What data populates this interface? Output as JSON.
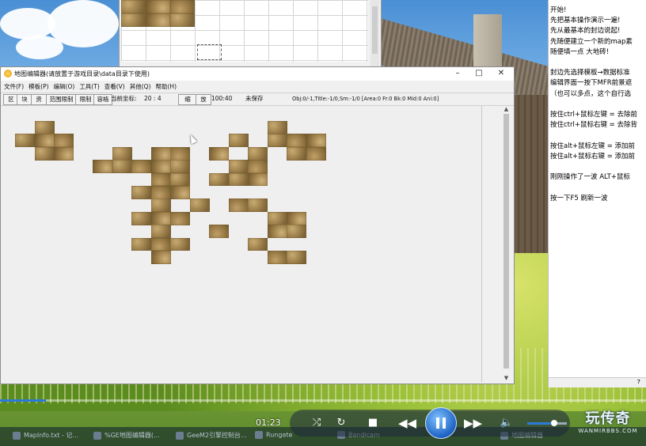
{
  "top_window": {
    "grid_tiles": [
      [
        0,
        0
      ],
      [
        1,
        0
      ],
      [
        2,
        0
      ],
      [
        0,
        1
      ],
      [
        1,
        1
      ],
      [
        2,
        1
      ]
    ]
  },
  "editor": {
    "title": "地图编辑器(请放置于游戏目录\\data目录下使用)",
    "window_buttons": {
      "minimize": "–",
      "maximize": "□",
      "close": "✕"
    },
    "menu": [
      "文件(F)",
      "模板(P)",
      "编辑(O)",
      "工具(T)",
      "查看(V)",
      "其他(Q)",
      "帮助(H)"
    ],
    "toolbar": {
      "btn1": "区",
      "btn2": "块",
      "btn3": "资",
      "btn4": "范围限制",
      "btn5": "限制",
      "btn6": "容格",
      "coord_label": "当前坐标:",
      "coord_value": "20 : 4",
      "btn_shrink": "缩",
      "btn_zoom": "放",
      "zoom_value": "100:40",
      "save_status": "未保存",
      "obj_info": "Obj:0/-1,Title:-1/0,Sm:-1/0 [Area:0 Fr:0 Bk:0 Mid:0 Ani:0]"
    },
    "tiles": [
      [
        1,
        0
      ],
      [
        0,
        1
      ],
      [
        1,
        1
      ],
      [
        2,
        1
      ],
      [
        1,
        2
      ],
      [
        2,
        2
      ],
      [
        5,
        2
      ],
      [
        8,
        2
      ],
      [
        10,
        2
      ],
      [
        12,
        2
      ],
      [
        13,
        1
      ],
      [
        14,
        1
      ],
      [
        13,
        0
      ],
      [
        14,
        2
      ],
      [
        15,
        1
      ],
      [
        15,
        2
      ],
      [
        11,
        1
      ],
      [
        4,
        3
      ],
      [
        5,
        3
      ],
      [
        6,
        3
      ],
      [
        7,
        3
      ],
      [
        8,
        3
      ],
      [
        11,
        3
      ],
      [
        12,
        3
      ],
      [
        10,
        4
      ],
      [
        11,
        4
      ],
      [
        7,
        2
      ],
      [
        7,
        4
      ],
      [
        8,
        4
      ],
      [
        12,
        4
      ],
      [
        6,
        5
      ],
      [
        7,
        5
      ],
      [
        8,
        5
      ],
      [
        7,
        6
      ],
      [
        9,
        6
      ],
      [
        11,
        6
      ],
      [
        12,
        6
      ],
      [
        6,
        7
      ],
      [
        7,
        7
      ],
      [
        8,
        7
      ],
      [
        13,
        7
      ],
      [
        14,
        7
      ],
      [
        7,
        8
      ],
      [
        10,
        8
      ],
      [
        13,
        8
      ],
      [
        14,
        8
      ],
      [
        6,
        9
      ],
      [
        7,
        9
      ],
      [
        8,
        9
      ],
      [
        12,
        9
      ],
      [
        7,
        10
      ],
      [
        13,
        10
      ],
      [
        14,
        10
      ]
    ]
  },
  "notepad": {
    "lines": [
      "开始!",
      "先把基本操作演示一遍!",
      "先从最基本的封边说起!",
      "先随便建立一个新的map素",
      "随便填一点 大地砖!",
      "",
      "封边先选择模板→数据标准",
      "编辑界面一按下MFR前景遮",
      "（也可以多点，这个自行选",
      "",
      "按住ctrl+鼠标左键 = 去除前",
      "按住ctrl+鼠标右键 = 去除背",
      "",
      "按住alt+鼠标左键 = 添加前",
      "按住alt+鼠标右键 = 添加前",
      "",
      "刚刚操作了一波 ALT+鼠标",
      "",
      "按一下F5 刷新一波"
    ],
    "status": "7"
  },
  "player": {
    "time": "01:23",
    "seek_progress": 0.071,
    "volume": 0.68,
    "logo_big": "玩传奇",
    "logo_small": "WANMIRBBS.COM"
  },
  "taskbar": {
    "items": [
      "MapInfo.txt - 记...",
      "%GE地图编辑器(...",
      "GeeM2引擎控制台...",
      "Rungate",
      "Bandicam",
      "地图编辑器"
    ]
  }
}
